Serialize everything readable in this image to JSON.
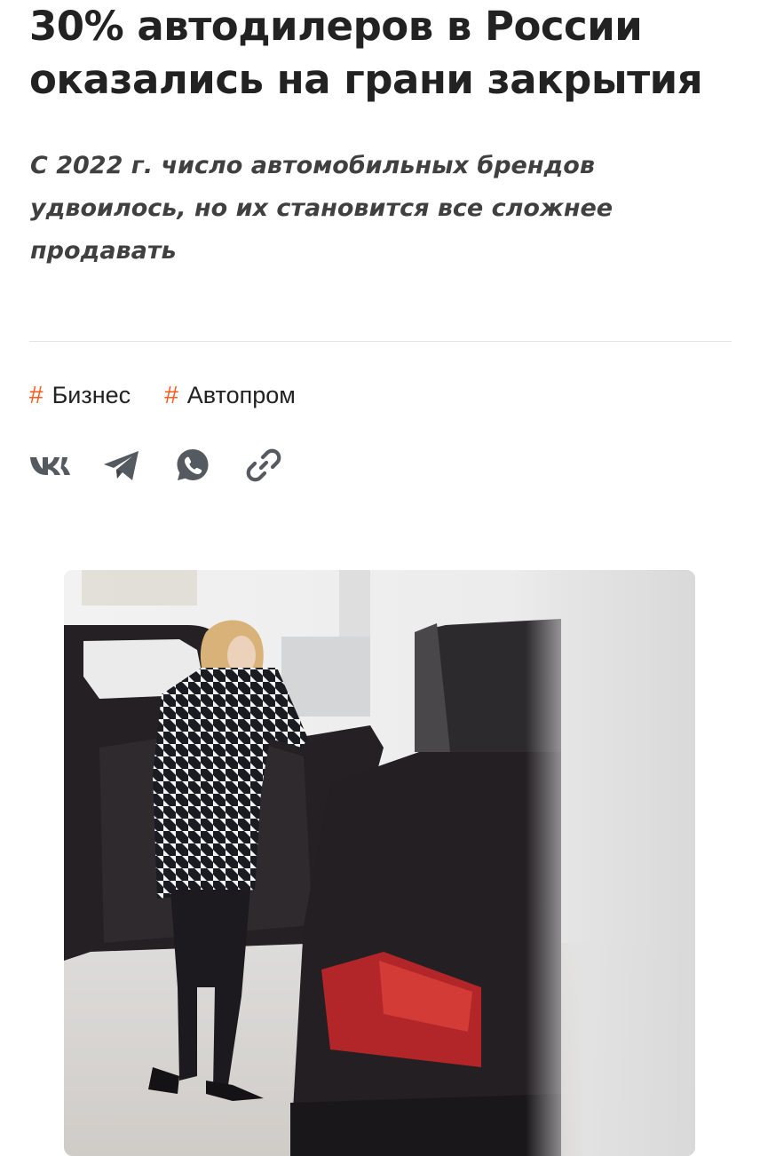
{
  "article": {
    "title_lines": [
      "30% автодилеров в России",
      "оказались на грани закрытия"
    ],
    "lead_lines": [
      "С 2022 г. число автомобильных брендов",
      "удвоилось, но их становится все сложнее",
      "продавать"
    ]
  },
  "tags": [
    {
      "hash": "#",
      "label": "Бизнес"
    },
    {
      "hash": "#",
      "label": "Автопром"
    }
  ],
  "share": {
    "buttons": [
      {
        "icon": "vk-icon"
      },
      {
        "icon": "telegram-icon"
      },
      {
        "icon": "whatsapp-icon"
      },
      {
        "icon": "link-icon"
      }
    ]
  },
  "colors": {
    "accent": "#ff5a1f",
    "text": "#222222",
    "lead_text": "#404040",
    "icon": "#545a60",
    "divider": "#e4e4e4"
  }
}
